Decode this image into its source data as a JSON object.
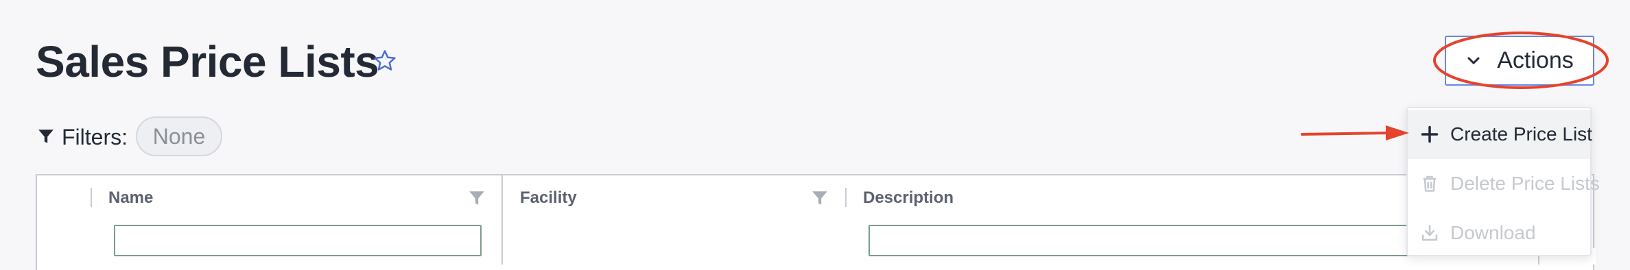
{
  "page": {
    "title": "Sales Price Lists"
  },
  "actions": {
    "label": "Actions"
  },
  "filters": {
    "label": "Filters:",
    "value": "None"
  },
  "table": {
    "columns": [
      {
        "label": "Name"
      },
      {
        "label": "Facility"
      },
      {
        "label": "Description"
      }
    ]
  },
  "menu": {
    "items": [
      {
        "label": "Create Price List",
        "icon": "plus-icon",
        "state": "enabled"
      },
      {
        "label": "Delete Price Lists",
        "icon": "trash-icon",
        "state": "disabled"
      },
      {
        "label": "Download",
        "icon": "download-icon",
        "state": "disabled"
      }
    ]
  },
  "colors": {
    "accent": "#6a86e0",
    "annotation": "#e5432c",
    "text": "#222a36",
    "disabled_text": "#c6c9cf"
  }
}
